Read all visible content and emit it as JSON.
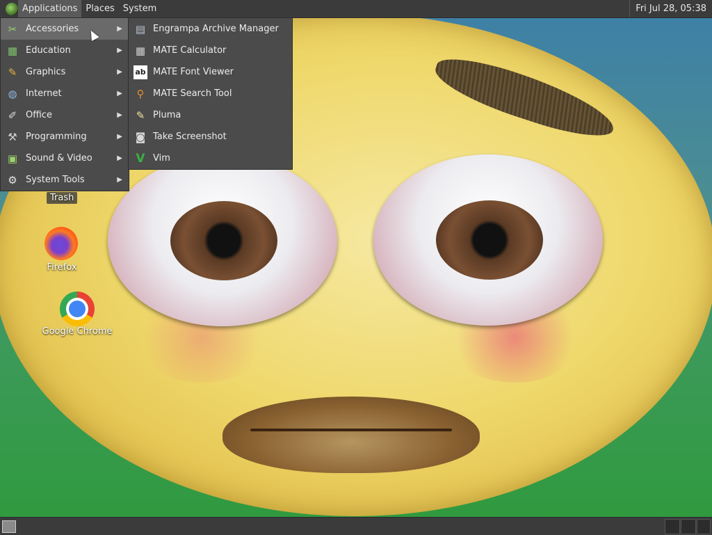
{
  "top_panel": {
    "menus": [
      "Applications",
      "Places",
      "System"
    ],
    "clock": "Fri Jul 28, 05:38"
  },
  "applications_menu": {
    "items": [
      {
        "label": "Accessories",
        "icon": "accessories-icon"
      },
      {
        "label": "Education",
        "icon": "education-icon"
      },
      {
        "label": "Graphics",
        "icon": "graphics-icon"
      },
      {
        "label": "Internet",
        "icon": "internet-icon"
      },
      {
        "label": "Office",
        "icon": "office-icon"
      },
      {
        "label": "Programming",
        "icon": "programming-icon"
      },
      {
        "label": "Sound & Video",
        "icon": "sound-video-icon"
      },
      {
        "label": "System Tools",
        "icon": "system-tools-icon"
      }
    ],
    "selected": "Accessories"
  },
  "accessories_menu": {
    "items": [
      {
        "label": "Engrampa Archive Manager",
        "icon": "archive-manager-icon"
      },
      {
        "label": "MATE Calculator",
        "icon": "calculator-icon"
      },
      {
        "label": "MATE Font Viewer",
        "icon": "font-viewer-icon"
      },
      {
        "label": "MATE Search Tool",
        "icon": "search-tool-icon"
      },
      {
        "label": "Pluma",
        "icon": "text-editor-icon"
      },
      {
        "label": "Take Screenshot",
        "icon": "screenshot-icon"
      },
      {
        "label": "Vim",
        "icon": "vim-icon"
      }
    ]
  },
  "desktop_icons": {
    "trash": "Trash",
    "firefox": "Firefox",
    "chrome": "Google Chrome"
  }
}
